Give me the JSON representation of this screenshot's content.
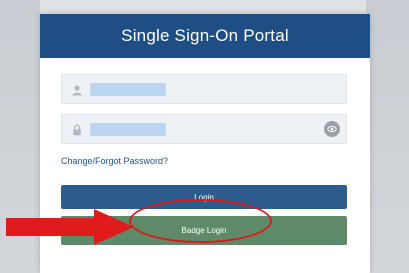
{
  "portal": {
    "title": "Single Sign-On Portal"
  },
  "form": {
    "username_icon": "user-icon",
    "password_icon": "lock-icon",
    "show_password_icon": "eye-icon",
    "forgot_link": "Change/Forgot Password?",
    "login_label": "Login",
    "badge_login_label": "Badge Login"
  },
  "annotation": {
    "arrow_icon": "right-arrow-icon",
    "highlight_color": "#d81c1c"
  },
  "colors": {
    "header": "#1f4e85",
    "login_button": "#2e5c8c",
    "badge_button": "#5f8a69"
  }
}
